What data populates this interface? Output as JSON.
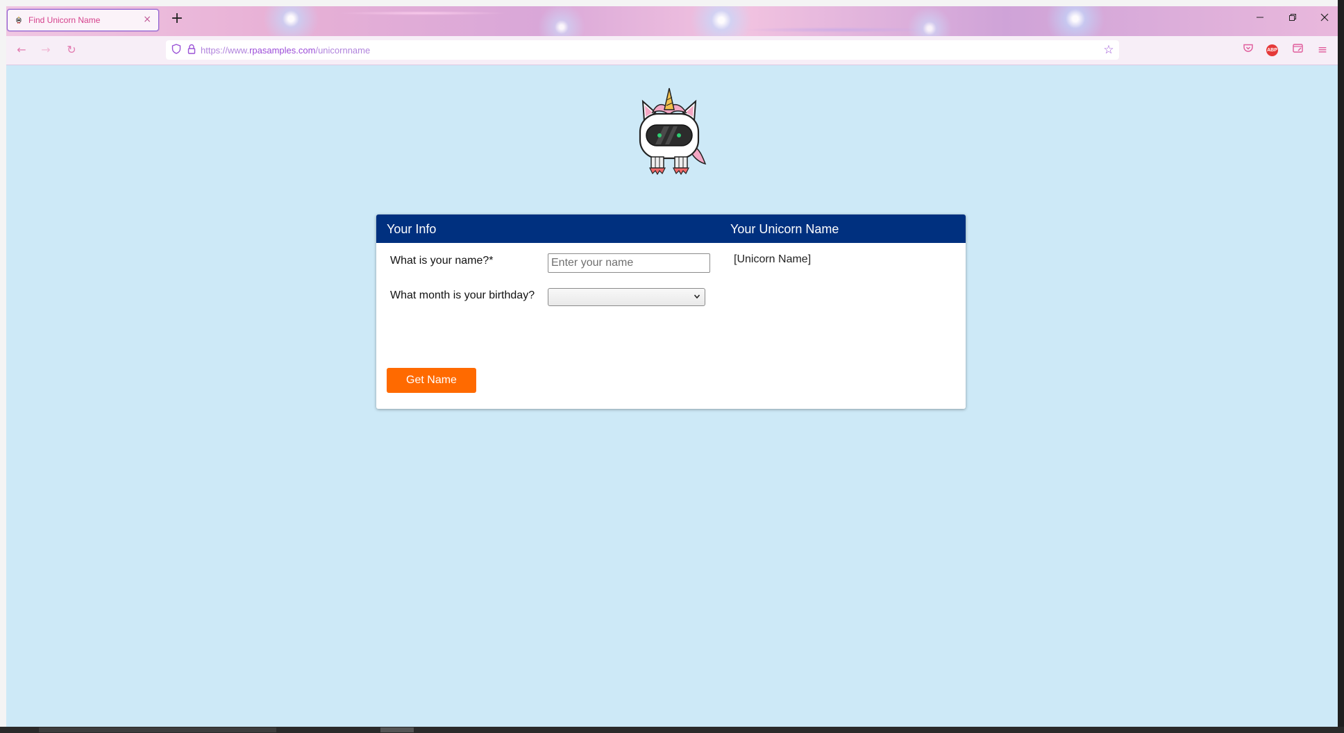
{
  "browser": {
    "tab": {
      "title": "Find Unicorn Name",
      "favicon": "unicorn-favicon-icon",
      "close": "×"
    },
    "new_tab": "+",
    "window_controls": {
      "minimize": "−",
      "restore": "❐",
      "close": "✕"
    },
    "nav": {
      "back": "←",
      "forward": "→",
      "reload": "↻"
    },
    "url": {
      "prefix": "https://www.",
      "domain": "rpasamples.com",
      "path": "/unicornname"
    },
    "toolbar_icons": [
      "pocket-icon",
      "adblock-icon",
      "reader-icon",
      "menu-icon"
    ],
    "adblock_label": "ABP",
    "menu_glyph": "≡",
    "star_glyph": "☆"
  },
  "page": {
    "colors": {
      "background": "#cde9f7",
      "header": "#00307f",
      "button": "#ff6a00"
    },
    "card": {
      "header_left": "Your Info",
      "header_right": "Your Unicorn Name",
      "name_label": "What is your name?*",
      "name_placeholder": "Enter your name",
      "name_value": "",
      "month_label": "What month is your birthday?",
      "month_selected": "",
      "unicorn_name": "[Unicorn Name]",
      "button_label": "Get Name"
    }
  }
}
